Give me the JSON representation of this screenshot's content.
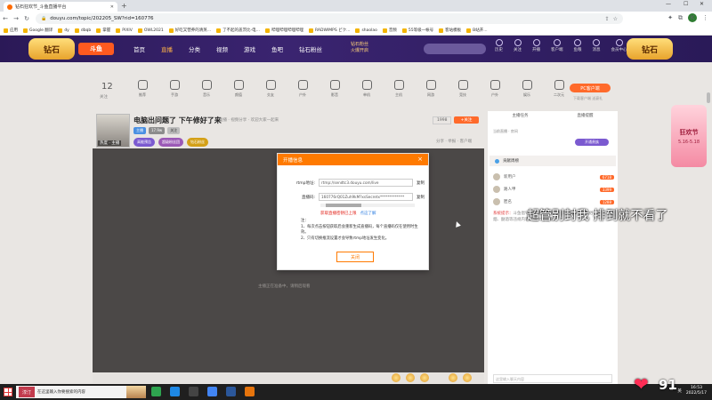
{
  "browser": {
    "tab_title": "钻石狂欢节_斗鱼直播平台",
    "url": "douyu.com/topic/202205_SW?rid=160776",
    "bookmarks": [
      "应用",
      "Google 翻译",
      "dy",
      "dbqb",
      "掌握",
      "PIXIV",
      "OWL2021",
      "好吃又营养的清蒸...",
      "了不起的盖茨比-电...",
      "哔哩哔哩哔哩哔哩",
      "RADWIMPS ピク...",
      "shaolao",
      "音频",
      "55等级一帐号",
      "客站模板",
      "B站开..."
    ]
  },
  "site": {
    "left_badge": "钻石",
    "brand": "斗鱼",
    "nav": [
      "首页",
      "直播",
      "分类",
      "视频",
      "游戏",
      "鱼吧",
      "钻石粉丝"
    ],
    "nav_sub": [
      "钻石粉丝",
      "火爆开启"
    ],
    "icons": [
      "历史",
      "关注",
      "开播",
      "客户端",
      "鱼粮",
      "消息",
      "会员中心"
    ],
    "right_badge": "钻石"
  },
  "category": {
    "count": "12",
    "count_label": "关注",
    "items": [
      "推荐",
      "手游",
      "音乐",
      "颜值",
      "交友",
      "户外",
      "影音",
      "单机",
      "主机",
      "网游",
      "竞技",
      "户外",
      "娱乐",
      "二次元"
    ],
    "pc_button": "PC客户端",
    "pc_sub": "下载客户端 送豪礼"
  },
  "room": {
    "meta": "热度 · 主播",
    "title": "电脑出问题了 下午修好了来",
    "sub": "直播 · 视频分享 · 欢迎大家一起来",
    "tags": [
      "主播",
      "17.9w",
      "关注"
    ],
    "badges": [
      "高能预告",
      "超级粉丝团",
      "钻石粉丝"
    ],
    "follow_count": "1998",
    "follow_label": "+关注",
    "tools": "分享 · 举报 · 客户端"
  },
  "player": {
    "hint": "主播正在准备中，请稍后观看"
  },
  "modal": {
    "title": "开播信息",
    "close_x": "×",
    "rtmp_label": "rtmp地址:",
    "rtmp_value": "rtmp://sendtc3.douyu.com/live",
    "key_label": "直播码:",
    "key_value": "160776rQ01Zuh9kM?xsSecretx*************",
    "copy_label": "复制",
    "warning": "获取直播密钥已上限",
    "warning_link": "点这了解",
    "notes": [
      "注：",
      "1、每次点击按钮获取后会重新生成直播码，每个直播码仅在使用时生效。",
      "2、只有切换推流设置才会导致rtmp地址发生变化。"
    ],
    "close_btn": "关闭"
  },
  "rpanel": {
    "tabs": [
      "主播任务",
      "直播提醒"
    ],
    "row2": "当前直播 · 房间",
    "pill": "开通贵族",
    "section": "贡献周榜",
    "list": [
      {
        "name": "新用户",
        "val": "6718"
      },
      {
        "name": "路人甲",
        "val": "3399"
      },
      {
        "name": "匿名",
        "val": "1288"
      }
    ],
    "notice_label": "系统提示：",
    "notice": "斗鱼倡导绿色健康直播，严禁涉及政治、低俗、色情、吸烟、酗酒等违规内容，请文明观看。",
    "input_placeholder": "这里输入聊天内容"
  },
  "overlay": {
    "danmaku": "超管别封我 排到就不看了",
    "ad_title": "狂欢节",
    "ad_sub": "5.16-5.18",
    "likes": "91"
  },
  "taskbar": {
    "search_text": "在这里输入你要搜索的内容",
    "search_logo": "淳汀",
    "tray": [
      "^",
      "英"
    ],
    "time": "16:53",
    "date": "2022/5/17"
  },
  "colors": {
    "accent": "#ff7a00",
    "brand": "#ff5a1f",
    "header_bg": "#2b1957",
    "player_bg": "#4b4847"
  }
}
